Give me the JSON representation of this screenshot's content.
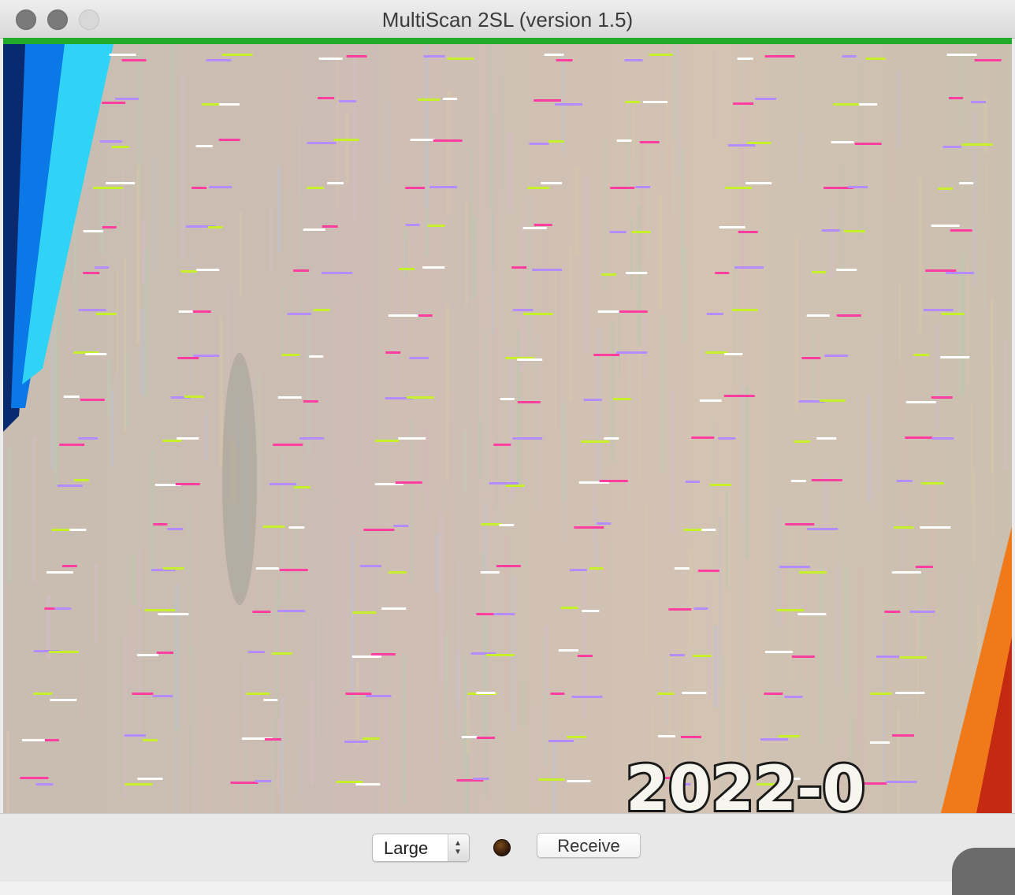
{
  "window": {
    "title": "MultiScan 2SL (version 1.5)"
  },
  "image": {
    "overlay_text": "2022-0",
    "colors": {
      "background": "#cdbfb2",
      "blue_band": "#0a78e6",
      "cyan_band": "#2fd3f5",
      "orange_band": "#f07a1a",
      "magenta_streak": "#ff3ea0",
      "violet_streak": "#b48cff",
      "lime_streak": "#c6f02a",
      "white_streak": "#ffffff"
    }
  },
  "controls": {
    "size_select_value": "Large",
    "receive_label": "Receive"
  }
}
